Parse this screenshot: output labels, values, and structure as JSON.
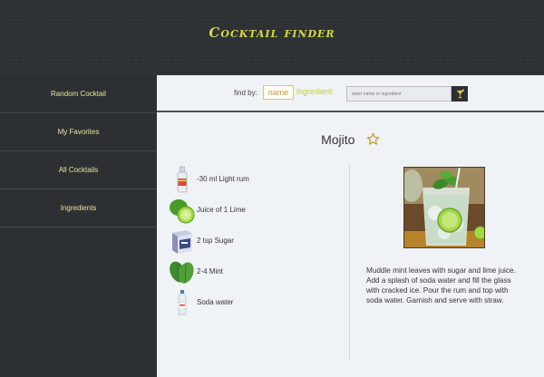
{
  "app": {
    "title": "Cocktail finder"
  },
  "sidebar": {
    "items": [
      {
        "label": "Random Cocktail"
      },
      {
        "label": "My Favorites"
      },
      {
        "label": "All Cocktails"
      },
      {
        "label": "Ingredients"
      }
    ]
  },
  "search": {
    "find_label": "find by:",
    "toggle_name": "name",
    "toggle_ingredient": "ingredient",
    "placeholder": "enter name or ingredient",
    "button_icon": "cocktail-glass-icon"
  },
  "drink": {
    "name": "Mojito",
    "favorite_icon": "star-outline-icon",
    "ingredients": [
      {
        "text": "-30 ml Light rum",
        "icon": "rum-bottle-icon"
      },
      {
        "text": "Juice of 1 Lime",
        "icon": "lime-icon"
      },
      {
        "text": "2 tsp Sugar",
        "icon": "sugar-box-icon"
      },
      {
        "text": "2-4 Mint",
        "icon": "mint-leaves-icon"
      },
      {
        "text": "Soda water",
        "icon": "soda-bottle-icon"
      }
    ],
    "instructions": "Muddle mint leaves with sugar and lime juice. Add a splash of soda water and fill the glass with cracked ice. Pour the rum and top with soda water. Garnish and serve with straw."
  },
  "colors": {
    "accent_yellow": "#d6d84a",
    "dark_bg": "#2d3033",
    "content_bg": "#f0f3f6",
    "star": "#c49a2a"
  }
}
